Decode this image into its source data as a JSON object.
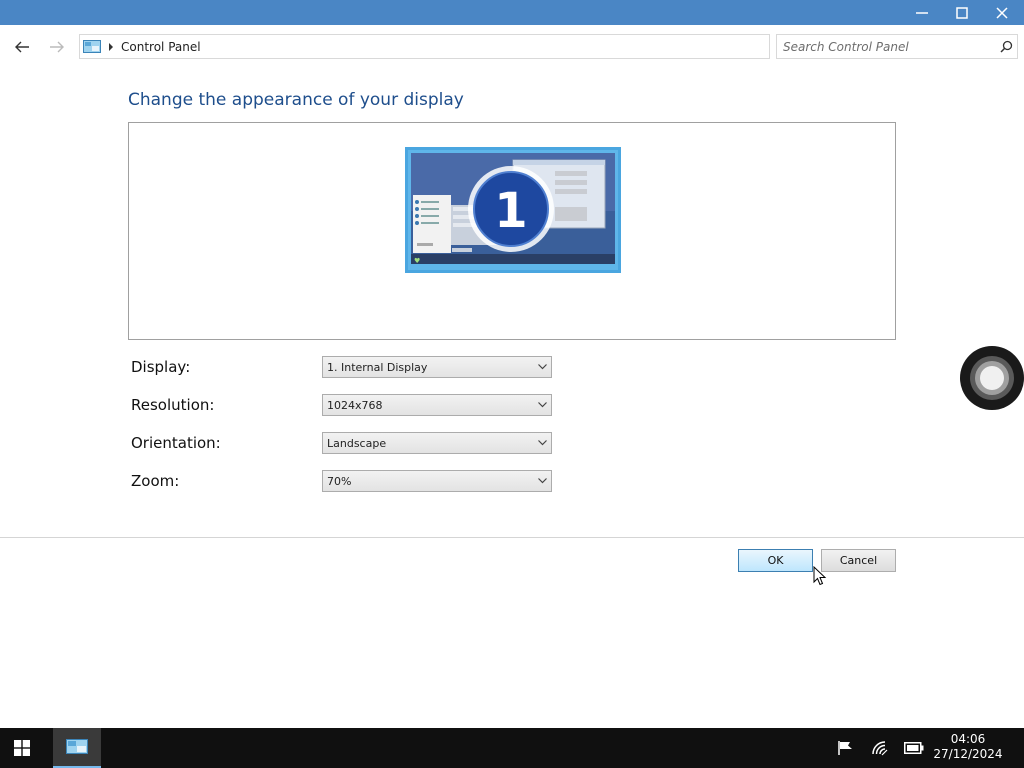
{
  "window": {
    "controls": [
      "minimize-icon",
      "maximize-icon",
      "close-icon"
    ]
  },
  "address": {
    "path": "Control Panel",
    "search_placeholder": "Search Control Panel"
  },
  "content": {
    "title": "Change the appearance of your display",
    "monitor_number": "1",
    "fields": [
      {
        "label": "Display:",
        "value": "1. Internal Display"
      },
      {
        "label": "Resolution:",
        "value": "1024x768"
      },
      {
        "label": "Orientation:",
        "value": "Landscape"
      },
      {
        "label": "Zoom:",
        "value": "70%"
      }
    ]
  },
  "buttons": {
    "ok": "OK",
    "cancel": "Cancel"
  },
  "taskbar": {
    "time": "04:06",
    "date": "27/12/2024"
  },
  "colors": {
    "titlebar": "#4a86c5",
    "title_text": "#1e4e8c",
    "taskbar": "#101010",
    "accent": "#76b9ed"
  }
}
